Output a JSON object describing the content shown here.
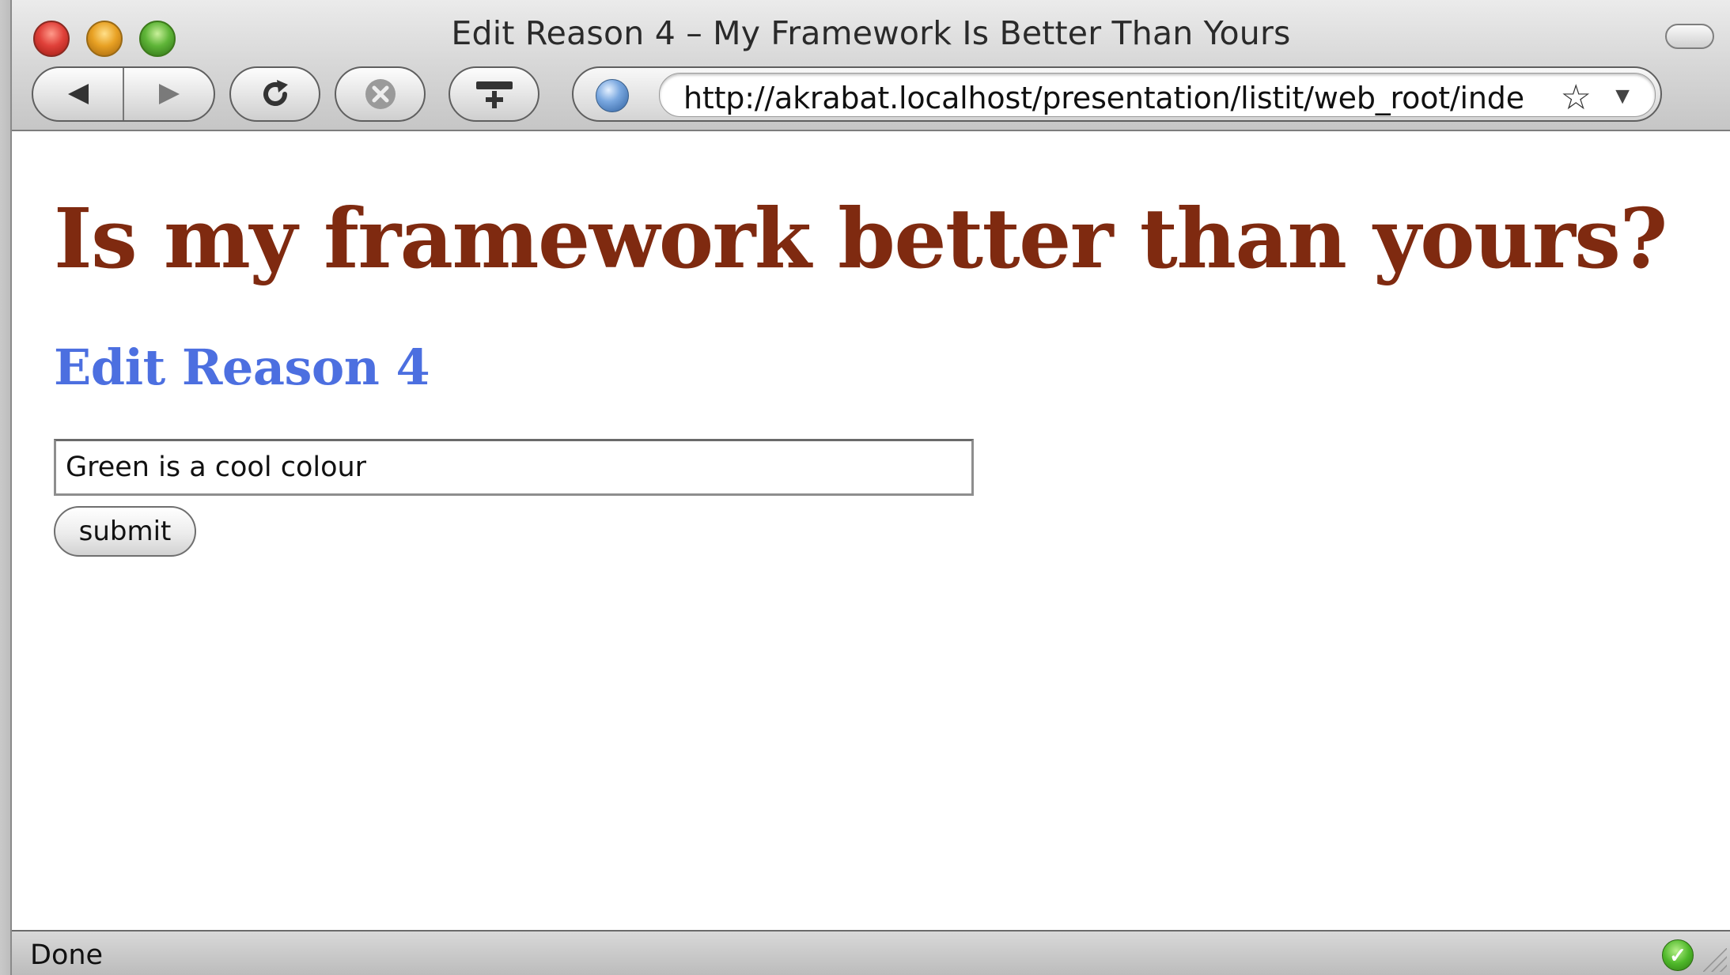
{
  "window": {
    "title": "Edit Reason 4 – My Framework Is Better Than Yours"
  },
  "toolbar": {
    "back_icon": "◀",
    "forward_icon": "▶",
    "reload_icon": "↻",
    "stop_icon": "✕",
    "add_bookmark_icon": "bookmark-plus",
    "site_icon": "globe",
    "url": "http://akrabat.localhost/presentation/listit/web_root/inde",
    "bookmark_star": "☆",
    "dropdown_caret": "▼"
  },
  "page": {
    "heading": "Is my framework better than yours?",
    "subheading": "Edit Reason 4",
    "reason_value": "Green is a cool colour",
    "submit_label": "submit"
  },
  "status": {
    "text": "Done",
    "secure_icon": "✓"
  },
  "colors": {
    "heading": "#7f2a10",
    "subheading": "#4c6fe0"
  }
}
